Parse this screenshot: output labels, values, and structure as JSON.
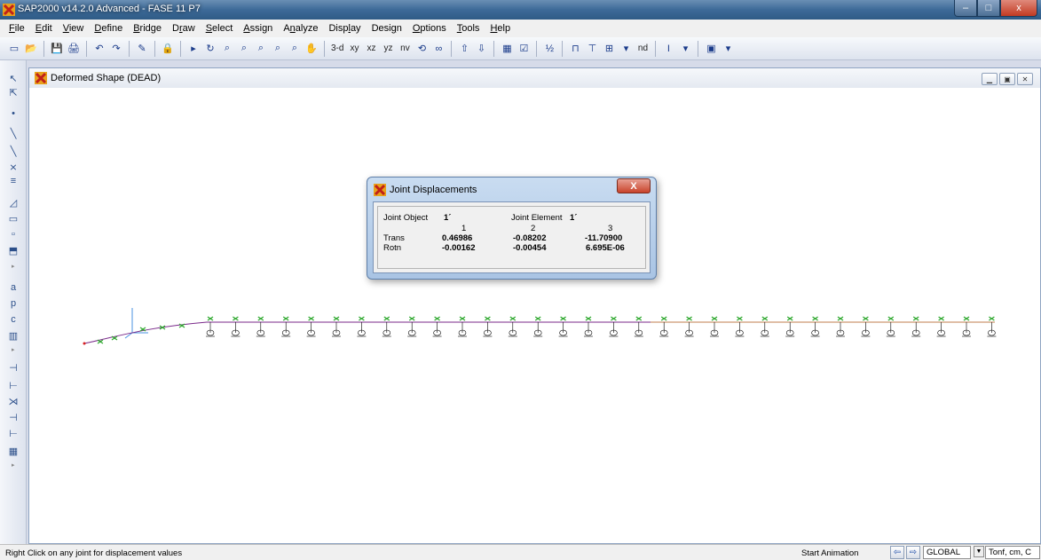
{
  "app": {
    "title": "SAP2000 v14.2.0 Advanced  - FASE 11 P7",
    "window_buttons": {
      "minimize": "–",
      "maximize": "□",
      "close": "x"
    }
  },
  "menu": [
    {
      "pre": "",
      "u": "F",
      "post": "ile"
    },
    {
      "pre": "",
      "u": "E",
      "post": "dit"
    },
    {
      "pre": "",
      "u": "V",
      "post": "iew"
    },
    {
      "pre": "",
      "u": "D",
      "post": "efine"
    },
    {
      "pre": "",
      "u": "B",
      "post": "ridge"
    },
    {
      "pre": "D",
      "u": "r",
      "post": "aw"
    },
    {
      "pre": "",
      "u": "S",
      "post": "elect"
    },
    {
      "pre": "",
      "u": "A",
      "post": "ssign"
    },
    {
      "pre": "A",
      "u": "n",
      "post": "alyze"
    },
    {
      "pre": "Disp",
      "u": "l",
      "post": "ay"
    },
    {
      "pre": "Desi",
      "u": "g",
      "post": "n"
    },
    {
      "pre": "",
      "u": "O",
      "post": "ptions"
    },
    {
      "pre": "",
      "u": "T",
      "post": "ools"
    },
    {
      "pre": "",
      "u": "H",
      "post": "elp"
    }
  ],
  "toolbar": {
    "view_3d": "3-d",
    "view_xy": "xy",
    "view_xz": "xz",
    "view_yz": "yz",
    "view_nv": "nv",
    "nd": "nd"
  },
  "document": {
    "title": "Deformed Shape (DEAD)"
  },
  "dialog": {
    "title": "Joint Displacements",
    "close_label": "X",
    "joint_object_label": "Joint Object",
    "joint_object_value": "1´",
    "joint_element_label": "Joint Element",
    "joint_element_value": "1´",
    "columns": [
      "1",
      "2",
      "3"
    ],
    "rows": [
      {
        "label": "Trans",
        "values": [
          "0.46986",
          "-0.08202",
          "-11.70900"
        ]
      },
      {
        "label": "Rotn",
        "values": [
          "-0.00162",
          "-0.00454",
          "6.695E-06"
        ]
      }
    ]
  },
  "status": {
    "hint": "Right Click on any joint for displacement values",
    "animation": "Start Animation",
    "coord_system": "GLOBAL",
    "units": "Tonf, cm, C"
  },
  "colors": {
    "beam": "#7a2a8a",
    "restraint": "#2ea82e",
    "support": "#000000"
  }
}
